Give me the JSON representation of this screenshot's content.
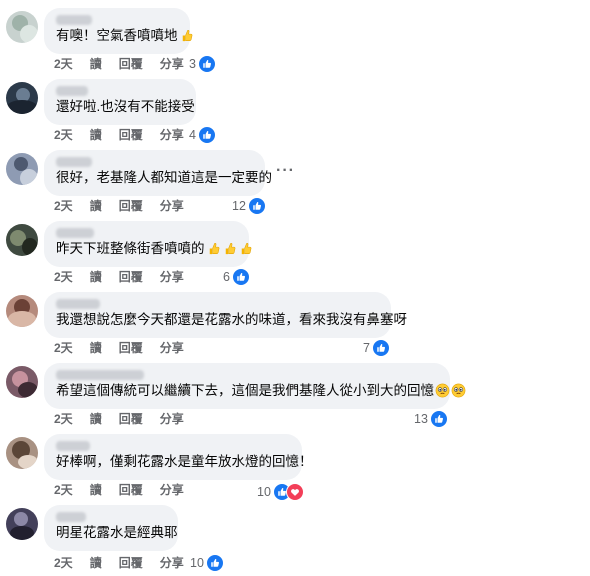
{
  "actions": {
    "reply_label": "回覆",
    "share_label": "分享",
    "read_label": "讀"
  },
  "comments": [
    {
      "text": "有噢！空氣香噴噴地",
      "time": "2天",
      "count": "3"
    },
    {
      "text": "還好啦.也沒有不能接受",
      "time": "2天",
      "count": "4"
    },
    {
      "text": "很好，老基隆人都知道這是一定要的",
      "time": "2天",
      "count": "12"
    },
    {
      "text": "昨天下班整條街香噴噴的",
      "time": "2天",
      "count": "6"
    },
    {
      "text": "我還想說怎麼今天都還是花露水的味道，看來我沒有鼻塞呀",
      "time": "2天",
      "count": "7"
    },
    {
      "text": "希望這個傳統可以繼續下去，這個是我們基隆人從小到大的回憶",
      "time": "2天",
      "count": "13"
    },
    {
      "text": "好棒啊，僅剩花露水是童年放水燈的回憶！",
      "time": "2天",
      "count": "10"
    },
    {
      "text": "明星花露水是經典耶",
      "time": "2天",
      "count": "10"
    }
  ],
  "icons": {
    "like": "thumbs-up-icon",
    "love": "heart-icon",
    "more": "more-options-icon"
  },
  "colors": {
    "like": "#1877f2",
    "love": "#f33e58",
    "bubble": "#f0f2f5",
    "meta": "#65676b"
  }
}
